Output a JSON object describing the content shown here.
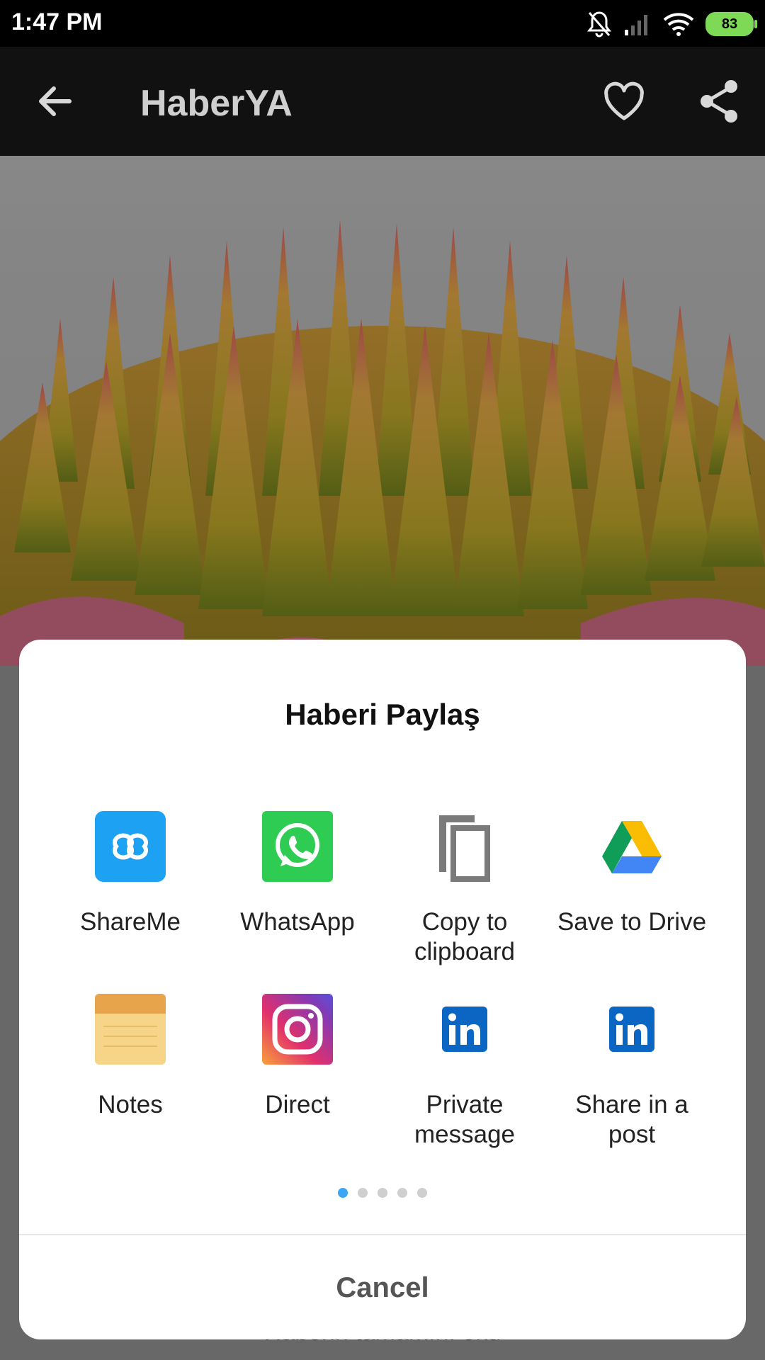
{
  "status": {
    "time": "1:47 PM",
    "battery": "83"
  },
  "appbar": {
    "title": "HaberYA",
    "back_icon": "arrow-back-icon",
    "favorite_icon": "heart-outline-icon",
    "share_icon": "share-icon"
  },
  "background_text": "Haberin tamamını oku",
  "share_sheet": {
    "title": "Haberi Paylaş",
    "targets": [
      {
        "label": "ShareMe",
        "icon": "shareme-icon",
        "color": "#1da1f2"
      },
      {
        "label": "WhatsApp",
        "icon": "whatsapp-icon",
        "color": "#2ecc52"
      },
      {
        "label": "Copy to clipboard",
        "icon": "copy-icon",
        "color": "#6e6e6e"
      },
      {
        "label": "Save to Drive",
        "icon": "google-drive-icon",
        "color": "#1e88e5"
      },
      {
        "label": "Notes",
        "icon": "notes-icon",
        "color": "#f4c86a"
      },
      {
        "label": "Direct",
        "icon": "instagram-icon",
        "color": "#c13584"
      },
      {
        "label": "Private message",
        "icon": "linkedin-icon",
        "color": "#0a66c2"
      },
      {
        "label": "Share in a post",
        "icon": "linkedin-icon",
        "color": "#0a66c2"
      }
    ],
    "page_count": 5,
    "active_page": 1,
    "cancel_label": "Cancel"
  }
}
